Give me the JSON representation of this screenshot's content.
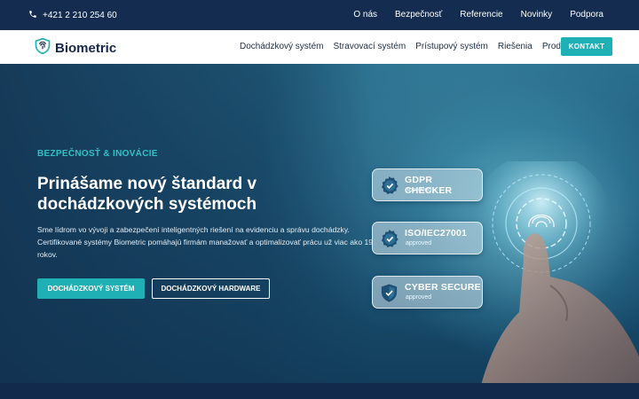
{
  "topbar": {
    "phone": "+421 2 210 254 60",
    "links": [
      "O nás",
      "Bezpečnosť",
      "Referencie",
      "Novinky",
      "Podpora"
    ]
  },
  "header": {
    "logo_text": "Biometric",
    "nav": [
      "Dochádzkový systém",
      "Stravovací systém",
      "Prístupový systém",
      "Riešenia",
      "Produkty"
    ],
    "cta": "KONTAKT"
  },
  "hero": {
    "eyebrow": "BEZPEČNOSŤ & INOVÁCIE",
    "title": "Prinášame nový štandard v dochádzkových systémoch",
    "description": "Sme lídrom vo vývoji a zabezpečení inteligentných riešení na evidenciu a správu dochádzky. Certifikované systémy Biometric pomáhajú firmám manažovať a optimalizovať prácu už viac ako 19 rokov.",
    "btn_primary": "DOCHÁDZKOVÝ SYSTÉM",
    "btn_secondary": "DOCHÁDZKOVÝ HARDWARE"
  },
  "badges": [
    {
      "title": "GDPR CHECKER",
      "subtitle": "approved",
      "icon": "check-badge-icon"
    },
    {
      "title": "ISO/IEC27001",
      "subtitle": "approved",
      "icon": "check-badge-icon"
    },
    {
      "title": "CYBER SECURE",
      "subtitle": "approved",
      "icon": "shield-check-icon"
    }
  ],
  "colors": {
    "accent": "#1fb0b6",
    "topbar": "#132c50",
    "brand_dark": "#16284a"
  }
}
